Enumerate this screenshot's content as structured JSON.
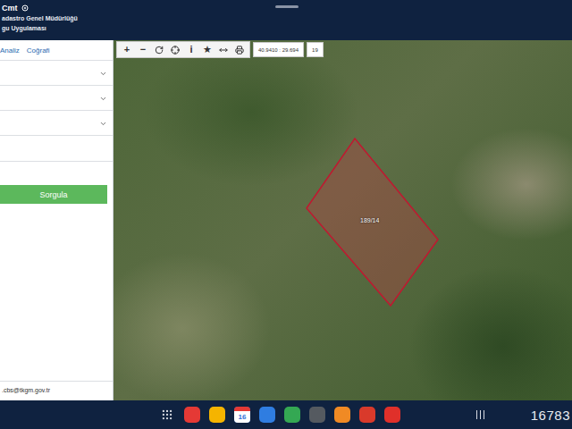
{
  "header": {
    "title": "Cmt",
    "lines": [
      "adastro Genel Müdürlüğü",
      "gu Uygulaması"
    ]
  },
  "sidebar": {
    "tabs": [
      {
        "label": "Analiz",
        "selected": false
      },
      {
        "label": "Coğrafi",
        "selected": false
      }
    ],
    "selects": [
      {
        "value": "",
        "expanded": false
      },
      {
        "value": "",
        "expanded": false
      },
      {
        "value": "",
        "expanded": false
      }
    ],
    "field": {
      "value": ""
    },
    "button": "Sorgula",
    "footer": ".cbs@tkgm.gov.tr"
  },
  "map": {
    "tools": [
      {
        "kind": "text",
        "text": "+"
      },
      {
        "kind": "text",
        "text": "−"
      },
      {
        "kind": "refresh",
        "text": ""
      },
      {
        "kind": "locate",
        "text": ""
      },
      {
        "kind": "text",
        "text": "i"
      },
      {
        "kind": "text",
        "text": "★"
      },
      {
        "kind": "measure",
        "text": ""
      },
      {
        "kind": "print",
        "text": ""
      }
    ],
    "coordinates": "40.9410 : 29.694",
    "zoom": "19",
    "parcel": {
      "label": "189/14",
      "selected": true
    }
  },
  "taskbar": {
    "apps": [
      {
        "kind": "grid",
        "text": "",
        "color": "#d0d4dc"
      },
      {
        "kind": "app",
        "text": "",
        "color": "#e53935"
      },
      {
        "kind": "app",
        "text": "",
        "color": "#f5b400"
      },
      {
        "kind": "calendar",
        "text": "16",
        "color": "#2f6fd6"
      },
      {
        "kind": "app",
        "text": "",
        "color": "#2f7de1"
      },
      {
        "kind": "app",
        "text": "",
        "color": "#34a853"
      },
      {
        "kind": "app",
        "text": "",
        "color": "#555a60"
      },
      {
        "kind": "app",
        "text": "",
        "color": "#f08a24"
      },
      {
        "kind": "app",
        "text": "",
        "color": "#d93a2b"
      },
      {
        "kind": "app",
        "text": "",
        "color": "#e0302a"
      }
    ],
    "counter": "16783"
  }
}
